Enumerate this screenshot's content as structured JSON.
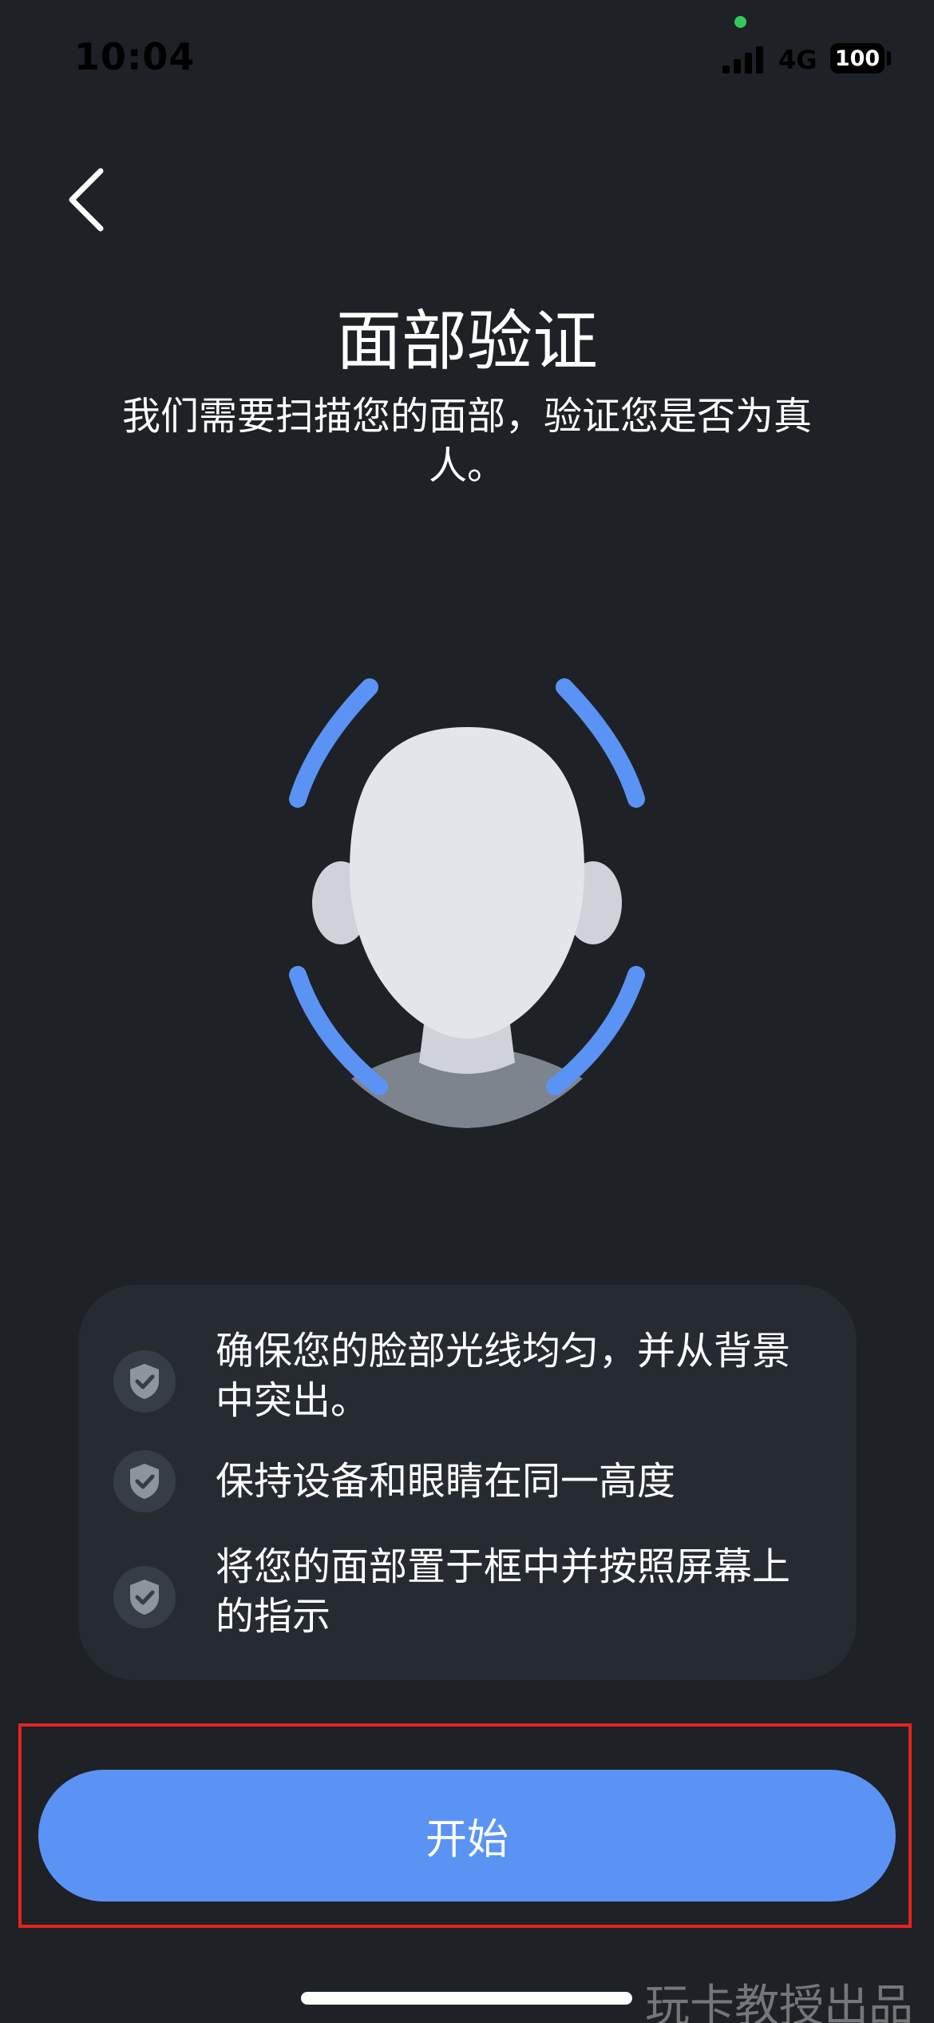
{
  "status_bar": {
    "time": "10:04",
    "network": "4G",
    "battery": "100"
  },
  "header": {
    "back_icon": "chevron-left-icon",
    "title": "面部验证",
    "subtitle": "我们需要扫描您的面部，验证您是否为真人。"
  },
  "illustration": {
    "name": "face-scan-illustration",
    "accent_color": "#5b93f5"
  },
  "tips": [
    {
      "icon": "shield-check-icon",
      "text": "确保您的脸部光线均匀，并从背景中突出。"
    },
    {
      "icon": "shield-check-icon",
      "text": "保持设备和眼睛在同一高度"
    },
    {
      "icon": "shield-check-icon",
      "text": "将您的面部置于框中并按照屏幕上的指示"
    }
  ],
  "start_button": {
    "label": "开始",
    "color": "#5b93f5"
  },
  "watermark": "玩卡教授出品",
  "colors": {
    "background": "#1e2126",
    "card": "#262b32",
    "highlight": "#e5231f"
  }
}
